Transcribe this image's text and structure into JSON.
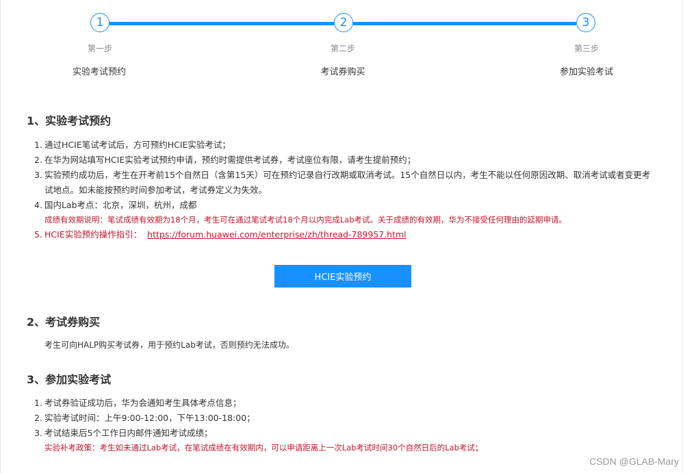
{
  "steps": [
    {
      "number": "1",
      "label": "第一步",
      "title": "实验考试预约"
    },
    {
      "number": "2",
      "label": "第二步",
      "title": "考试券购买"
    },
    {
      "number": "3",
      "label": "第三步",
      "title": "参加实验考试"
    }
  ],
  "section1": {
    "title": "1、实验考试预约",
    "items": [
      {
        "num": "1.",
        "text": "通过HCIE笔试考试后，方可预约HCIE实验考试；"
      },
      {
        "num": "2.",
        "text": "在华为网站填写HCIE实验考试预约申请，预约时需提供考试券，考试座位有限，请考生提前预约；"
      },
      {
        "num": "3.",
        "text": "实验预约成功后，考生在开考前15个自然日（含第15天）可在预约记录自行改期或取消考试。15个自然日以内，考生不能以任何原因改期、取消考试或者变更考试地点。如未能按预约时间参加考试，考试券定义为失效。"
      },
      {
        "num": "4.",
        "text": "国内Lab考点：北京，深圳，杭州，成都"
      },
      {
        "num": "5.",
        "text": "HCIE实验预约操作指引：",
        "link": "https://forum.huawei.com/enterprise/zh/thread-789957.html"
      }
    ],
    "validity_note": "成绩有效期说明：笔试成绩有效期为18个月，考生可在通过笔试考试18个月以内完成Lab考试。关于成绩的有效期，华为不接受任何理由的延期申请。",
    "button_label": "HCIE实验预约"
  },
  "section2": {
    "title": "2、考试券购买",
    "text": "考生可向HALP购买考试券，用于预约Lab考试，否则预约无法成功。"
  },
  "section3": {
    "title": "3、参加实验考试",
    "items": [
      {
        "num": "1.",
        "text": "考试券验证成功后，华为会通知考生具体考点信息；"
      },
      {
        "num": "2.",
        "text": "实验考试时间：上午9:00-12:00，下午13:00-18:00；"
      },
      {
        "num": "3.",
        "text": "考试结束后5个工作日内邮件通知考试成绩；"
      }
    ],
    "retake_note": "实验补考政策：考生如未通过Lab考试，在笔试成绩在有效期内，可以申请距离上一次Lab考试时间30个自然日后的Lab考试；"
  },
  "watermark": "CSDN @GLAB-Mary",
  "colors": {
    "accent": "#1890ff",
    "note_red": "#c0172b"
  }
}
